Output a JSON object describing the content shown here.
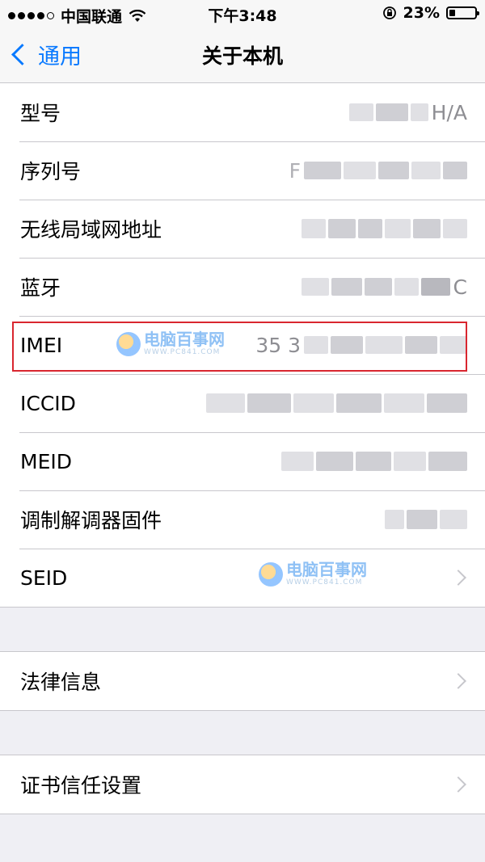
{
  "status_bar": {
    "carrier": "中国联通",
    "time": "下午3:48",
    "battery_percent": "23%",
    "battery_level": 0.23,
    "icons": [
      "signal-dots-icon",
      "wifi-icon",
      "rotation-lock-icon",
      "battery-icon"
    ]
  },
  "nav": {
    "back_label": "通用",
    "title": "关于本机"
  },
  "rows": [
    {
      "label": "型号",
      "value_suffix": "H/A"
    },
    {
      "label": "序列号",
      "value_prefix": "F"
    },
    {
      "label": "无线局域网地址"
    },
    {
      "label": "蓝牙",
      "value_suffix": "C"
    },
    {
      "label": "IMEI",
      "value_prefix": "35 3"
    },
    {
      "label": "ICCID"
    },
    {
      "label": "MEID"
    },
    {
      "label": "调制解调器固件"
    },
    {
      "label": "SEID"
    }
  ],
  "group2": [
    {
      "label": "法律信息"
    }
  ],
  "group3": [
    {
      "label": "证书信任设置"
    }
  ],
  "watermark": {
    "main": "电脑百事网",
    "sub": "WWW.PC841.COM"
  },
  "colors": {
    "accent": "#0a7aff",
    "highlight": "#d9262f",
    "background": "#efeff4"
  }
}
